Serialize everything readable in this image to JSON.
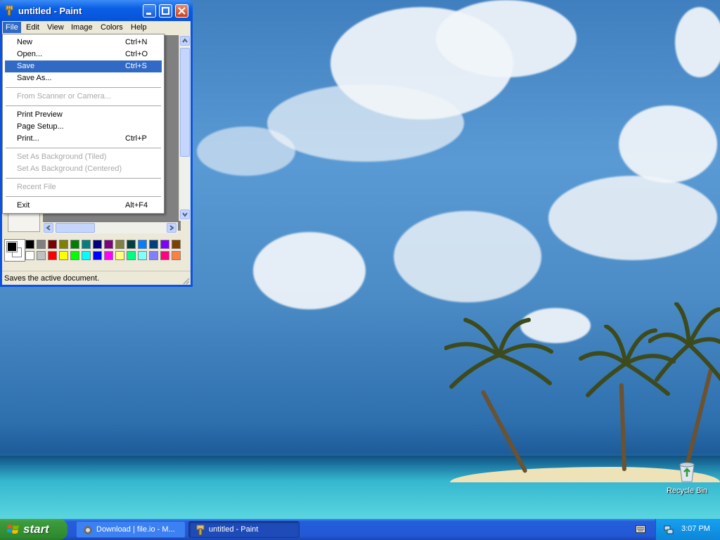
{
  "window": {
    "title": "untitled - Paint",
    "controls": [
      "minimize-icon",
      "maximize-icon",
      "close-icon"
    ]
  },
  "menubar": {
    "items": [
      "File",
      "Edit",
      "View",
      "Image",
      "Colors",
      "Help"
    ],
    "active": "File"
  },
  "file_menu": {
    "items": [
      {
        "label": "New",
        "shortcut": "Ctrl+N",
        "enabled": true
      },
      {
        "label": "Open...",
        "shortcut": "Ctrl+O",
        "enabled": true
      },
      {
        "label": "Save",
        "shortcut": "Ctrl+S",
        "enabled": true,
        "highlighted": true
      },
      {
        "label": "Save As...",
        "shortcut": "",
        "enabled": true
      },
      {
        "label": "From Scanner or Camera...",
        "shortcut": "",
        "enabled": false
      },
      {
        "label": "Print Preview",
        "shortcut": "",
        "enabled": true
      },
      {
        "label": "Page Setup...",
        "shortcut": "",
        "enabled": true
      },
      {
        "label": "Print...",
        "shortcut": "Ctrl+P",
        "enabled": true
      },
      {
        "label": "Set As Background (Tiled)",
        "shortcut": "",
        "enabled": false
      },
      {
        "label": "Set As Background (Centered)",
        "shortcut": "",
        "enabled": false
      },
      {
        "label": "Recent File",
        "shortcut": "",
        "enabled": false
      },
      {
        "label": "Exit",
        "shortcut": "Alt+F4",
        "enabled": true
      }
    ]
  },
  "palette": {
    "foreground": "#000000",
    "background": "#ffffff",
    "row1": [
      "#000000",
      "#808080",
      "#800000",
      "#808000",
      "#008000",
      "#008080",
      "#000080",
      "#800080",
      "#808040",
      "#004040",
      "#0080ff",
      "#004080",
      "#8000ff",
      "#804000"
    ],
    "row2": [
      "#ffffff",
      "#c0c0c0",
      "#ff0000",
      "#ffff00",
      "#00ff00",
      "#00ffff",
      "#0000ff",
      "#ff00ff",
      "#ffff80",
      "#00ff80",
      "#80ffff",
      "#8080ff",
      "#ff0080",
      "#ff8040"
    ]
  },
  "statusbar": {
    "text": "Saves the active document."
  },
  "desktop": {
    "icons": [
      {
        "label": "Recycle Bin",
        "icon": "recycle-bin-icon"
      }
    ]
  },
  "taskbar": {
    "start_label": "start",
    "tasks": [
      {
        "label": "Download | file.io - M...",
        "icon": "browser-icon",
        "active": false
      },
      {
        "label": "untitled - Paint",
        "icon": "paint-icon",
        "active": true
      }
    ],
    "clock": "3:07 PM"
  }
}
